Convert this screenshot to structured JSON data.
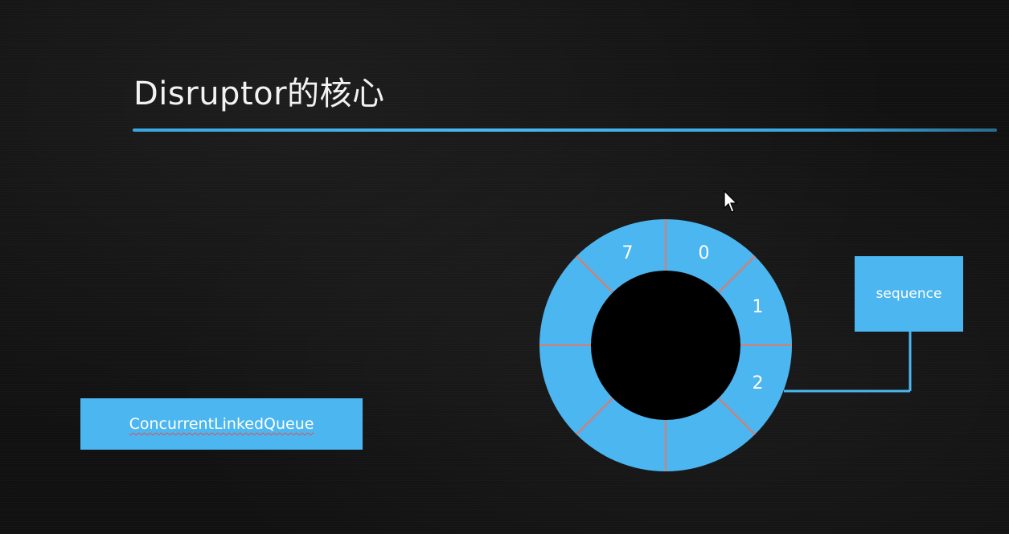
{
  "slide": {
    "title": "Disruptor的核心",
    "queue_label": "ConcurrentLinkedQueue",
    "sequence_label": "sequence",
    "ring_buffer": {
      "slot_count": 8,
      "slot_labels": [
        "0",
        "1",
        "2",
        "",
        "",
        "",
        "",
        "7"
      ]
    }
  },
  "colors": {
    "accent": "#4bb6f0",
    "divider": "#e07a6a",
    "background": "#111111",
    "text": "#ffffff"
  }
}
